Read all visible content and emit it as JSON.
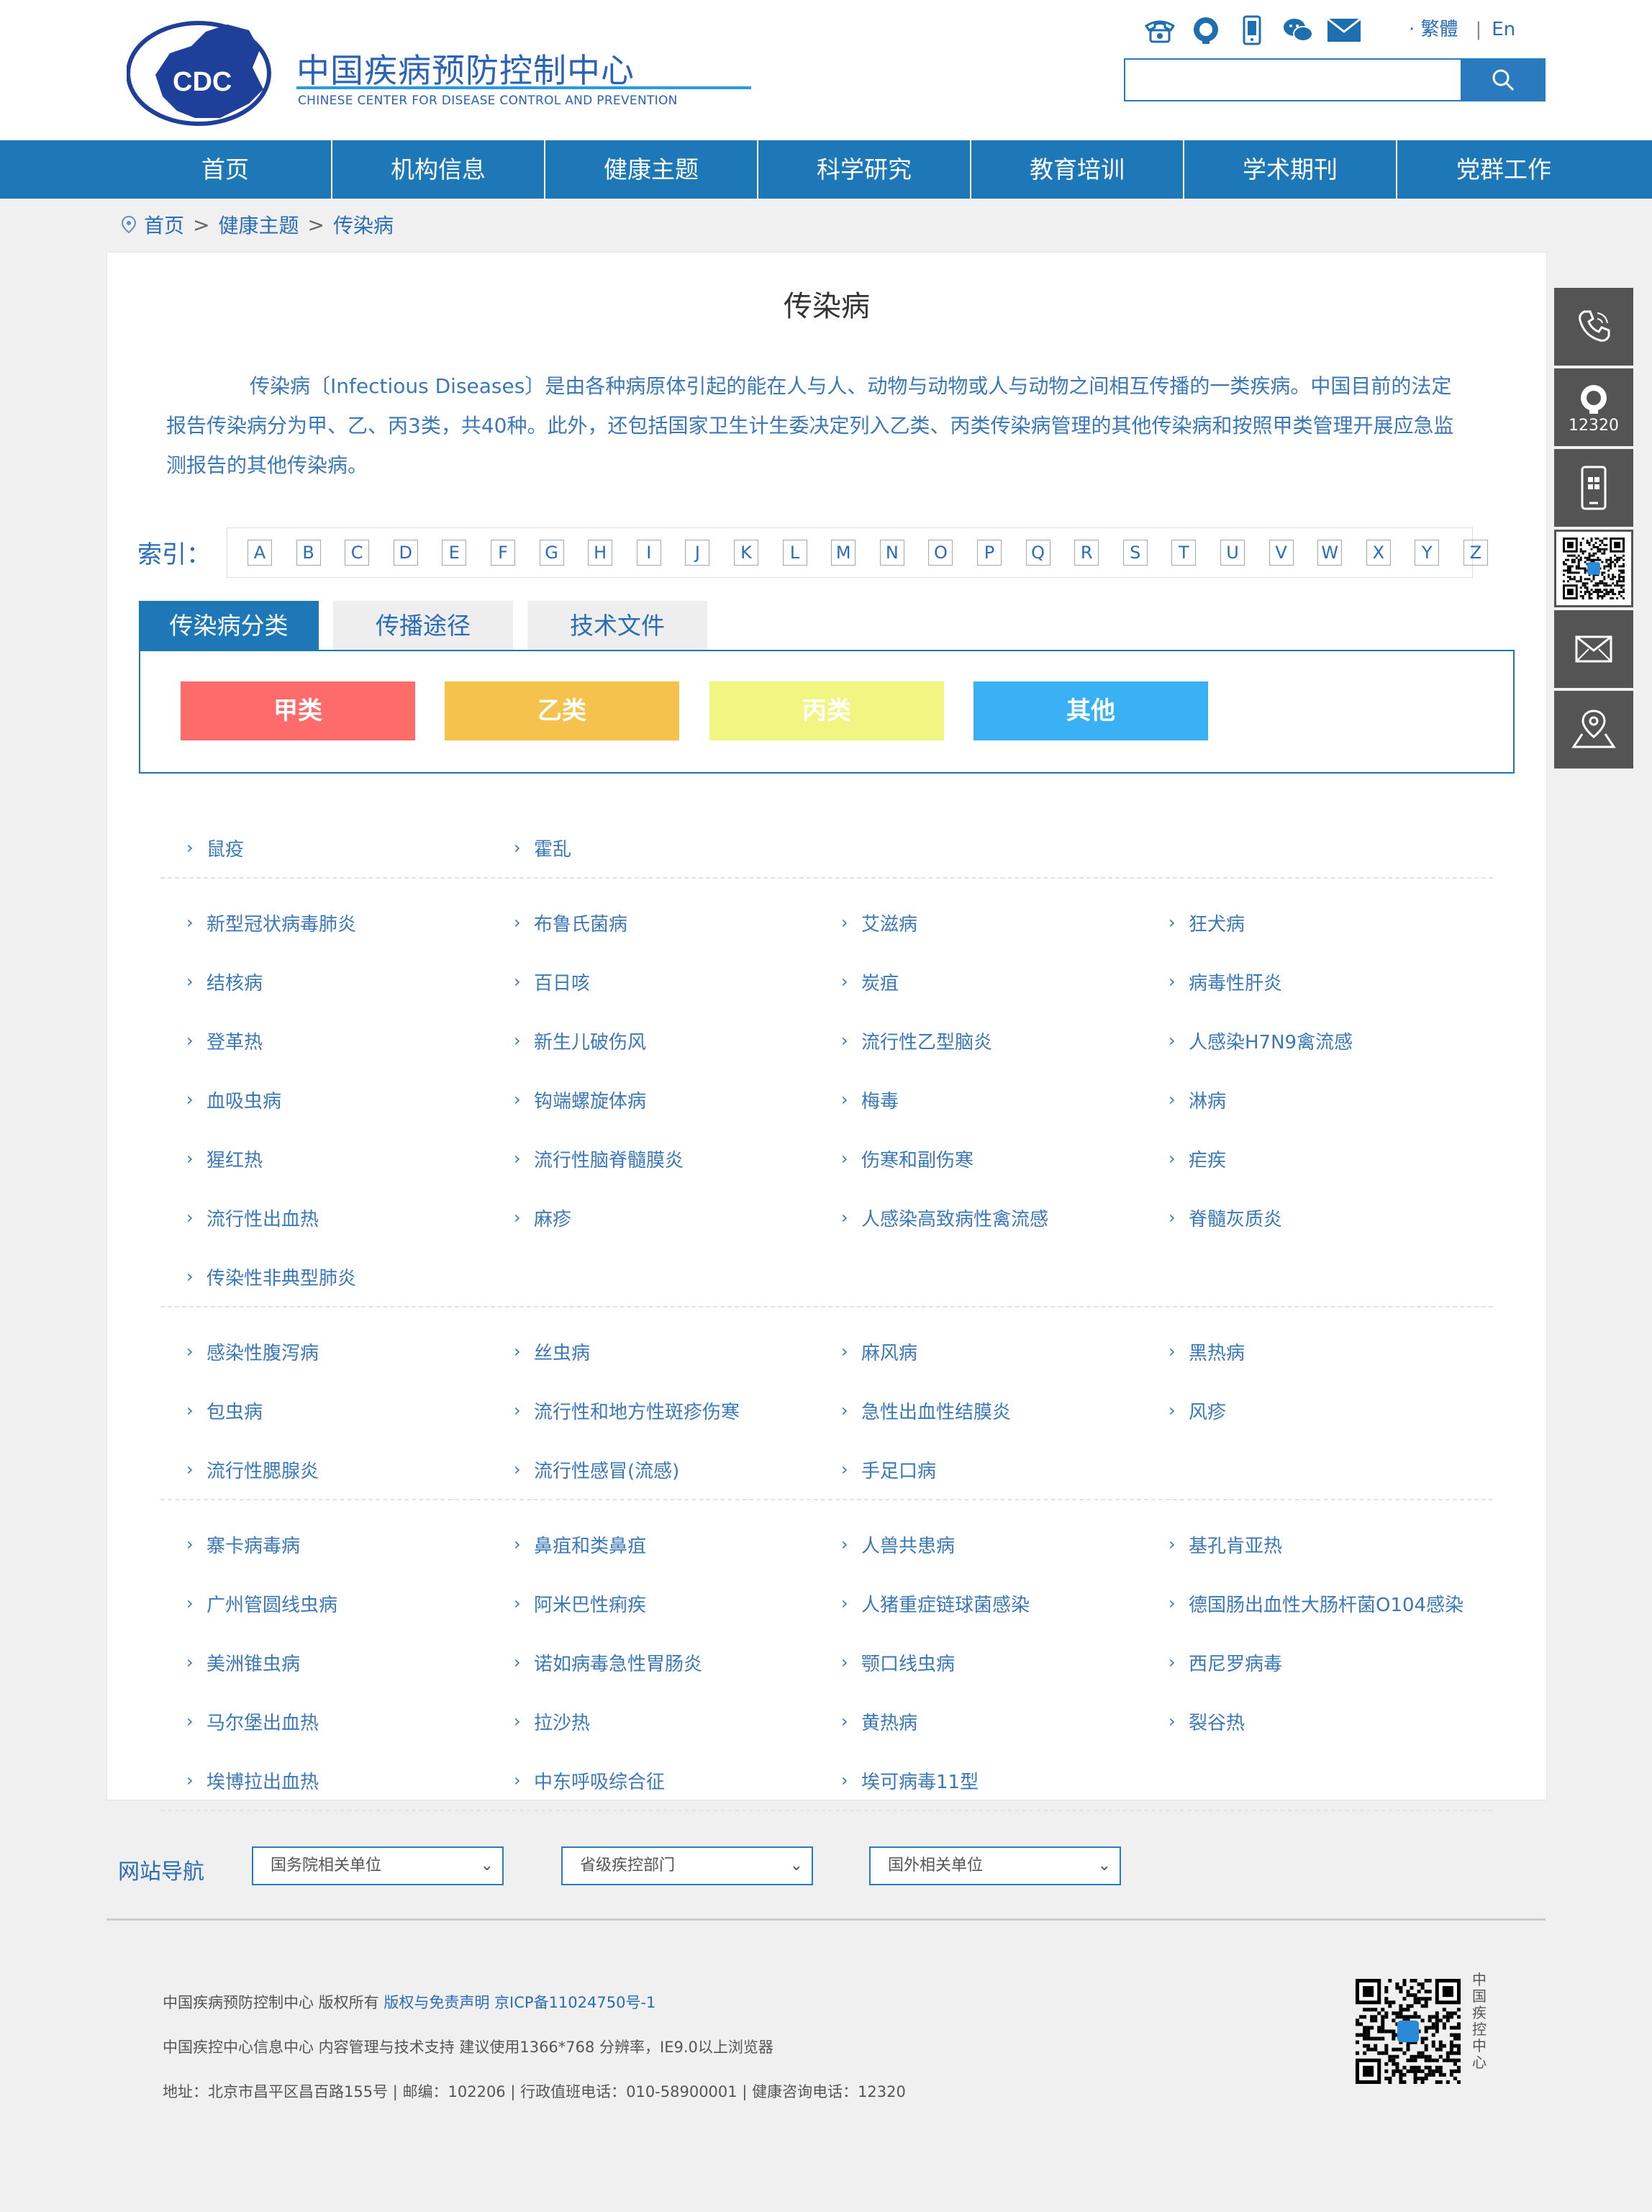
{
  "header": {
    "logo_cn": "中国疾病预防控制中心",
    "logo_en": "CHINESE CENTER FOR DISEASE CONTROL AND PREVENTION",
    "logo_mark": "CDC",
    "lang_traditional": "· 繁體",
    "lang_sep": "|",
    "lang_en": "En",
    "search_placeholder": "",
    "icons": [
      "phone-icon",
      "hotline-icon",
      "mobile-icon",
      "wechat-icon",
      "mail-icon"
    ]
  },
  "nav": [
    "首页",
    "机构信息",
    "健康主题",
    "科学研究",
    "教育培训",
    "学术期刊",
    "党群工作"
  ],
  "breadcrumb": {
    "items": [
      "首页",
      "健康主题",
      "传染病"
    ],
    "sep": ">"
  },
  "page": {
    "title": "传染病",
    "intro": "传染病〔Infectious Diseases〕是由各种病原体引起的能在人与人、动物与动物或人与动物之间相互传播的一类疾病。中国目前的法定报告传染病分为甲、乙、丙3类，共40种。此外，还包括国家卫生计生委决定列入乙类、丙类传染病管理的其他传染病和按照甲类管理开展应急监测报告的其他传染病。"
  },
  "index": {
    "label": "索引：",
    "letters": [
      "A",
      "B",
      "C",
      "D",
      "E",
      "F",
      "G",
      "H",
      "I",
      "J",
      "K",
      "L",
      "M",
      "N",
      "O",
      "P",
      "Q",
      "R",
      "S",
      "T",
      "U",
      "V",
      "W",
      "X",
      "Y",
      "Z"
    ]
  },
  "tabs": [
    {
      "label": "传染病分类",
      "active": true
    },
    {
      "label": "传播途径",
      "active": false
    },
    {
      "label": "技术文件",
      "active": false
    }
  ],
  "categories": [
    {
      "label": "甲类",
      "color": "#fd6b6b"
    },
    {
      "label": "乙类",
      "color": "#f5c24e"
    },
    {
      "label": "丙类",
      "color": "#f2f582"
    },
    {
      "label": "其他",
      "color": "#3ab1f4"
    }
  ],
  "disease_groups": [
    [
      [
        "鼠疫",
        "霍乱"
      ]
    ],
    [
      [
        "新型冠状病毒肺炎",
        "布鲁氏菌病",
        "艾滋病",
        "狂犬病"
      ],
      [
        "结核病",
        "百日咳",
        "炭疽",
        "病毒性肝炎"
      ],
      [
        "登革热",
        "新生儿破伤风",
        "流行性乙型脑炎",
        "人感染H7N9禽流感"
      ],
      [
        "血吸虫病",
        "钩端螺旋体病",
        "梅毒",
        "淋病"
      ],
      [
        "猩红热",
        "流行性脑脊髓膜炎",
        "伤寒和副伤寒",
        "疟疾"
      ],
      [
        "流行性出血热",
        "麻疹",
        "人感染高致病性禽流感",
        "脊髓灰质炎"
      ],
      [
        "传染性非典型肺炎"
      ]
    ],
    [
      [
        "感染性腹泻病",
        "丝虫病",
        "麻风病",
        "黑热病"
      ],
      [
        "包虫病",
        "流行性和地方性斑疹伤寒",
        "急性出血性结膜炎",
        "风疹"
      ],
      [
        "流行性腮腺炎",
        "流行性感冒(流感)",
        "手足口病"
      ]
    ],
    [
      [
        "寨卡病毒病",
        "鼻疽和类鼻疽",
        "人兽共患病",
        "基孔肯亚热"
      ],
      [
        "广州管圆线虫病",
        "阿米巴性痢疾",
        "人猪重症链球菌感染",
        "德国肠出血性大肠杆菌O104感染"
      ],
      [
        "美洲锥虫病",
        "诺如病毒急性胃肠炎",
        "颚口线虫病",
        "西尼罗病毒"
      ],
      [
        "马尔堡出血热",
        "拉沙热",
        "黄热病",
        "裂谷热"
      ],
      [
        "埃博拉出血热",
        "中东呼吸综合征",
        "埃可病毒11型"
      ]
    ]
  ],
  "site_nav": {
    "label": "网站导航",
    "selects": [
      "国务院相关单位",
      "省级疾控部门",
      "国外相关单位"
    ]
  },
  "footer": {
    "line1_a": "中国疾病预防控制中心 版权所有 ",
    "line1_link1": "版权与免责声明",
    "line1_link2": "京ICP备11024750号-1",
    "line2": "中国疾控中心信息中心 内容管理与技术支持 建议使用1366*768 分辨率，IE9.0以上浏览器",
    "line3": "地址：北京市昌平区昌百路155号 | 邮编：102206 | 行政值班电话：010-58900001 | 健康咨询电话：12320",
    "qr_caption": "中国疾控中心"
  },
  "side_bar": {
    "hotline": "12320"
  }
}
